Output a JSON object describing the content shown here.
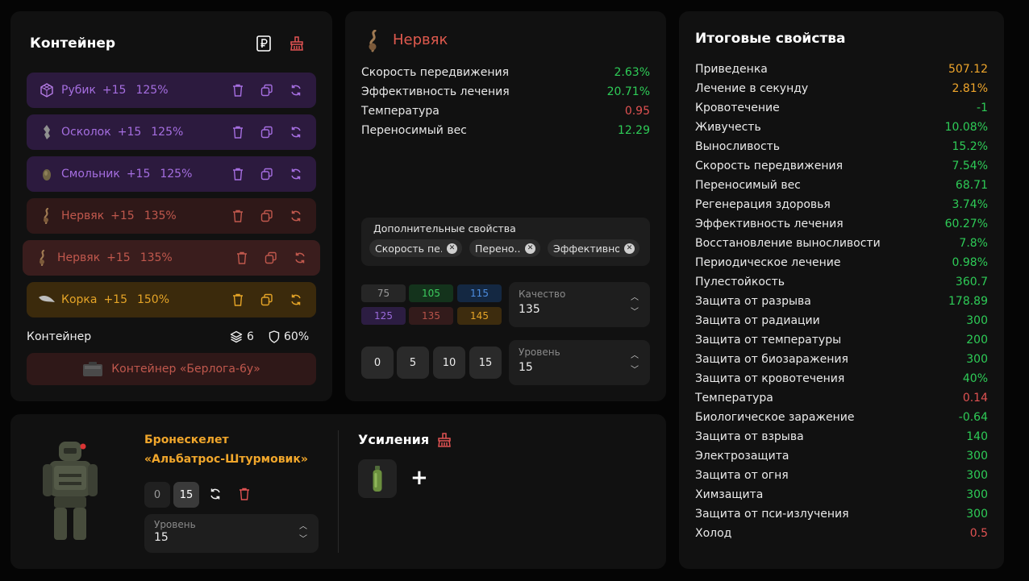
{
  "container_panel": {
    "title": "Контейнер",
    "artifacts": [
      {
        "name": "Рубик",
        "plus": "+15",
        "percent": "125%"
      },
      {
        "name": "Осколок",
        "plus": "+15",
        "percent": "125%"
      },
      {
        "name": "Смольник",
        "plus": "+15",
        "percent": "125%"
      },
      {
        "name": "Нервяк",
        "plus": "+15",
        "percent": "135%"
      },
      {
        "name": "Нервяк",
        "plus": "+15",
        "percent": "135%"
      },
      {
        "name": "Корка",
        "plus": "+15",
        "percent": "150%"
      }
    ],
    "footer_label": "Контейнер",
    "slots": "6",
    "protection": "60%",
    "container_name": "Контейнер «Берлога-6у»"
  },
  "item_panel": {
    "name": "Нервяк",
    "stats": [
      {
        "label": "Скорость передвижения",
        "value": "2.63%"
      },
      {
        "label": "Эффективность лечения",
        "value": "20.71%"
      },
      {
        "label": "Температура",
        "value": "0.95"
      },
      {
        "label": "Переносимый вес",
        "value": "12.29"
      }
    ],
    "extra_title": "Дополнительные свойства",
    "chips": [
      "Скорость пе...",
      "Перено...",
      "Эффективно..."
    ],
    "quality_values": [
      "75",
      "105",
      "115",
      "125",
      "135",
      "145"
    ],
    "quality_label": "Качество",
    "quality_value": "135",
    "level_buttons": [
      "0",
      "5",
      "10",
      "15"
    ],
    "level_label": "Уровень",
    "level_value": "15"
  },
  "armor_panel": {
    "name_line1": "Бронескелет",
    "name_line2": "«Альбатрос-Штурмовик»",
    "level_buttons": [
      "0",
      "15"
    ],
    "level_label": "Уровень",
    "level_value": "15",
    "boosts_title": "Усиления",
    "add_symbol": "+"
  },
  "totals_panel": {
    "title": "Итоговые свойства",
    "rows": [
      {
        "label": "Приведенка",
        "value": "507.12",
        "color": "orange"
      },
      {
        "label": "Лечение в секунду",
        "value": "2.81%",
        "color": "orange"
      },
      {
        "label": "Кровотечение",
        "value": "-1",
        "color": "green"
      },
      {
        "label": "Живучесть",
        "value": "10.08%",
        "color": "green"
      },
      {
        "label": "Выносливость",
        "value": "15.2%",
        "color": "green"
      },
      {
        "label": "Скорость передвижения",
        "value": "7.54%",
        "color": "green"
      },
      {
        "label": "Переносимый вес",
        "value": "68.71",
        "color": "green"
      },
      {
        "label": "Регенерация здоровья",
        "value": "3.74%",
        "color": "green"
      },
      {
        "label": "Эффективность лечения",
        "value": "60.27%",
        "color": "green"
      },
      {
        "label": "Восстановление выносливости",
        "value": "7.8%",
        "color": "green"
      },
      {
        "label": "Периодическое лечение",
        "value": "0.98%",
        "color": "green"
      },
      {
        "label": "Пулестойкость",
        "value": "360.7",
        "color": "green"
      },
      {
        "label": "Защита от разрыва",
        "value": "178.89",
        "color": "green"
      },
      {
        "label": "Защита от радиации",
        "value": "300",
        "color": "green"
      },
      {
        "label": "Защита от температуры",
        "value": "200",
        "color": "green"
      },
      {
        "label": "Защита от биозаражения",
        "value": "300",
        "color": "green"
      },
      {
        "label": "Защита от кровотечения",
        "value": "40%",
        "color": "green"
      },
      {
        "label": "Температура",
        "value": "0.14",
        "color": "red"
      },
      {
        "label": "Биологическое заражение",
        "value": "-0.64",
        "color": "green"
      },
      {
        "label": "Защита от взрыва",
        "value": "140",
        "color": "green"
      },
      {
        "label": "Электрозащита",
        "value": "300",
        "color": "green"
      },
      {
        "label": "Защита от огня",
        "value": "300",
        "color": "green"
      },
      {
        "label": "Химзащита",
        "value": "300",
        "color": "green"
      },
      {
        "label": "Защита от пси-излучения",
        "value": "300",
        "color": "green"
      },
      {
        "label": "Холод",
        "value": "0.5",
        "color": "red"
      }
    ]
  },
  "colors": {
    "green": "#2ecc57",
    "red": "#e05252",
    "orange": "#f0a62b",
    "purple": "#a56ee0",
    "artifact_red": "#c0584d"
  }
}
